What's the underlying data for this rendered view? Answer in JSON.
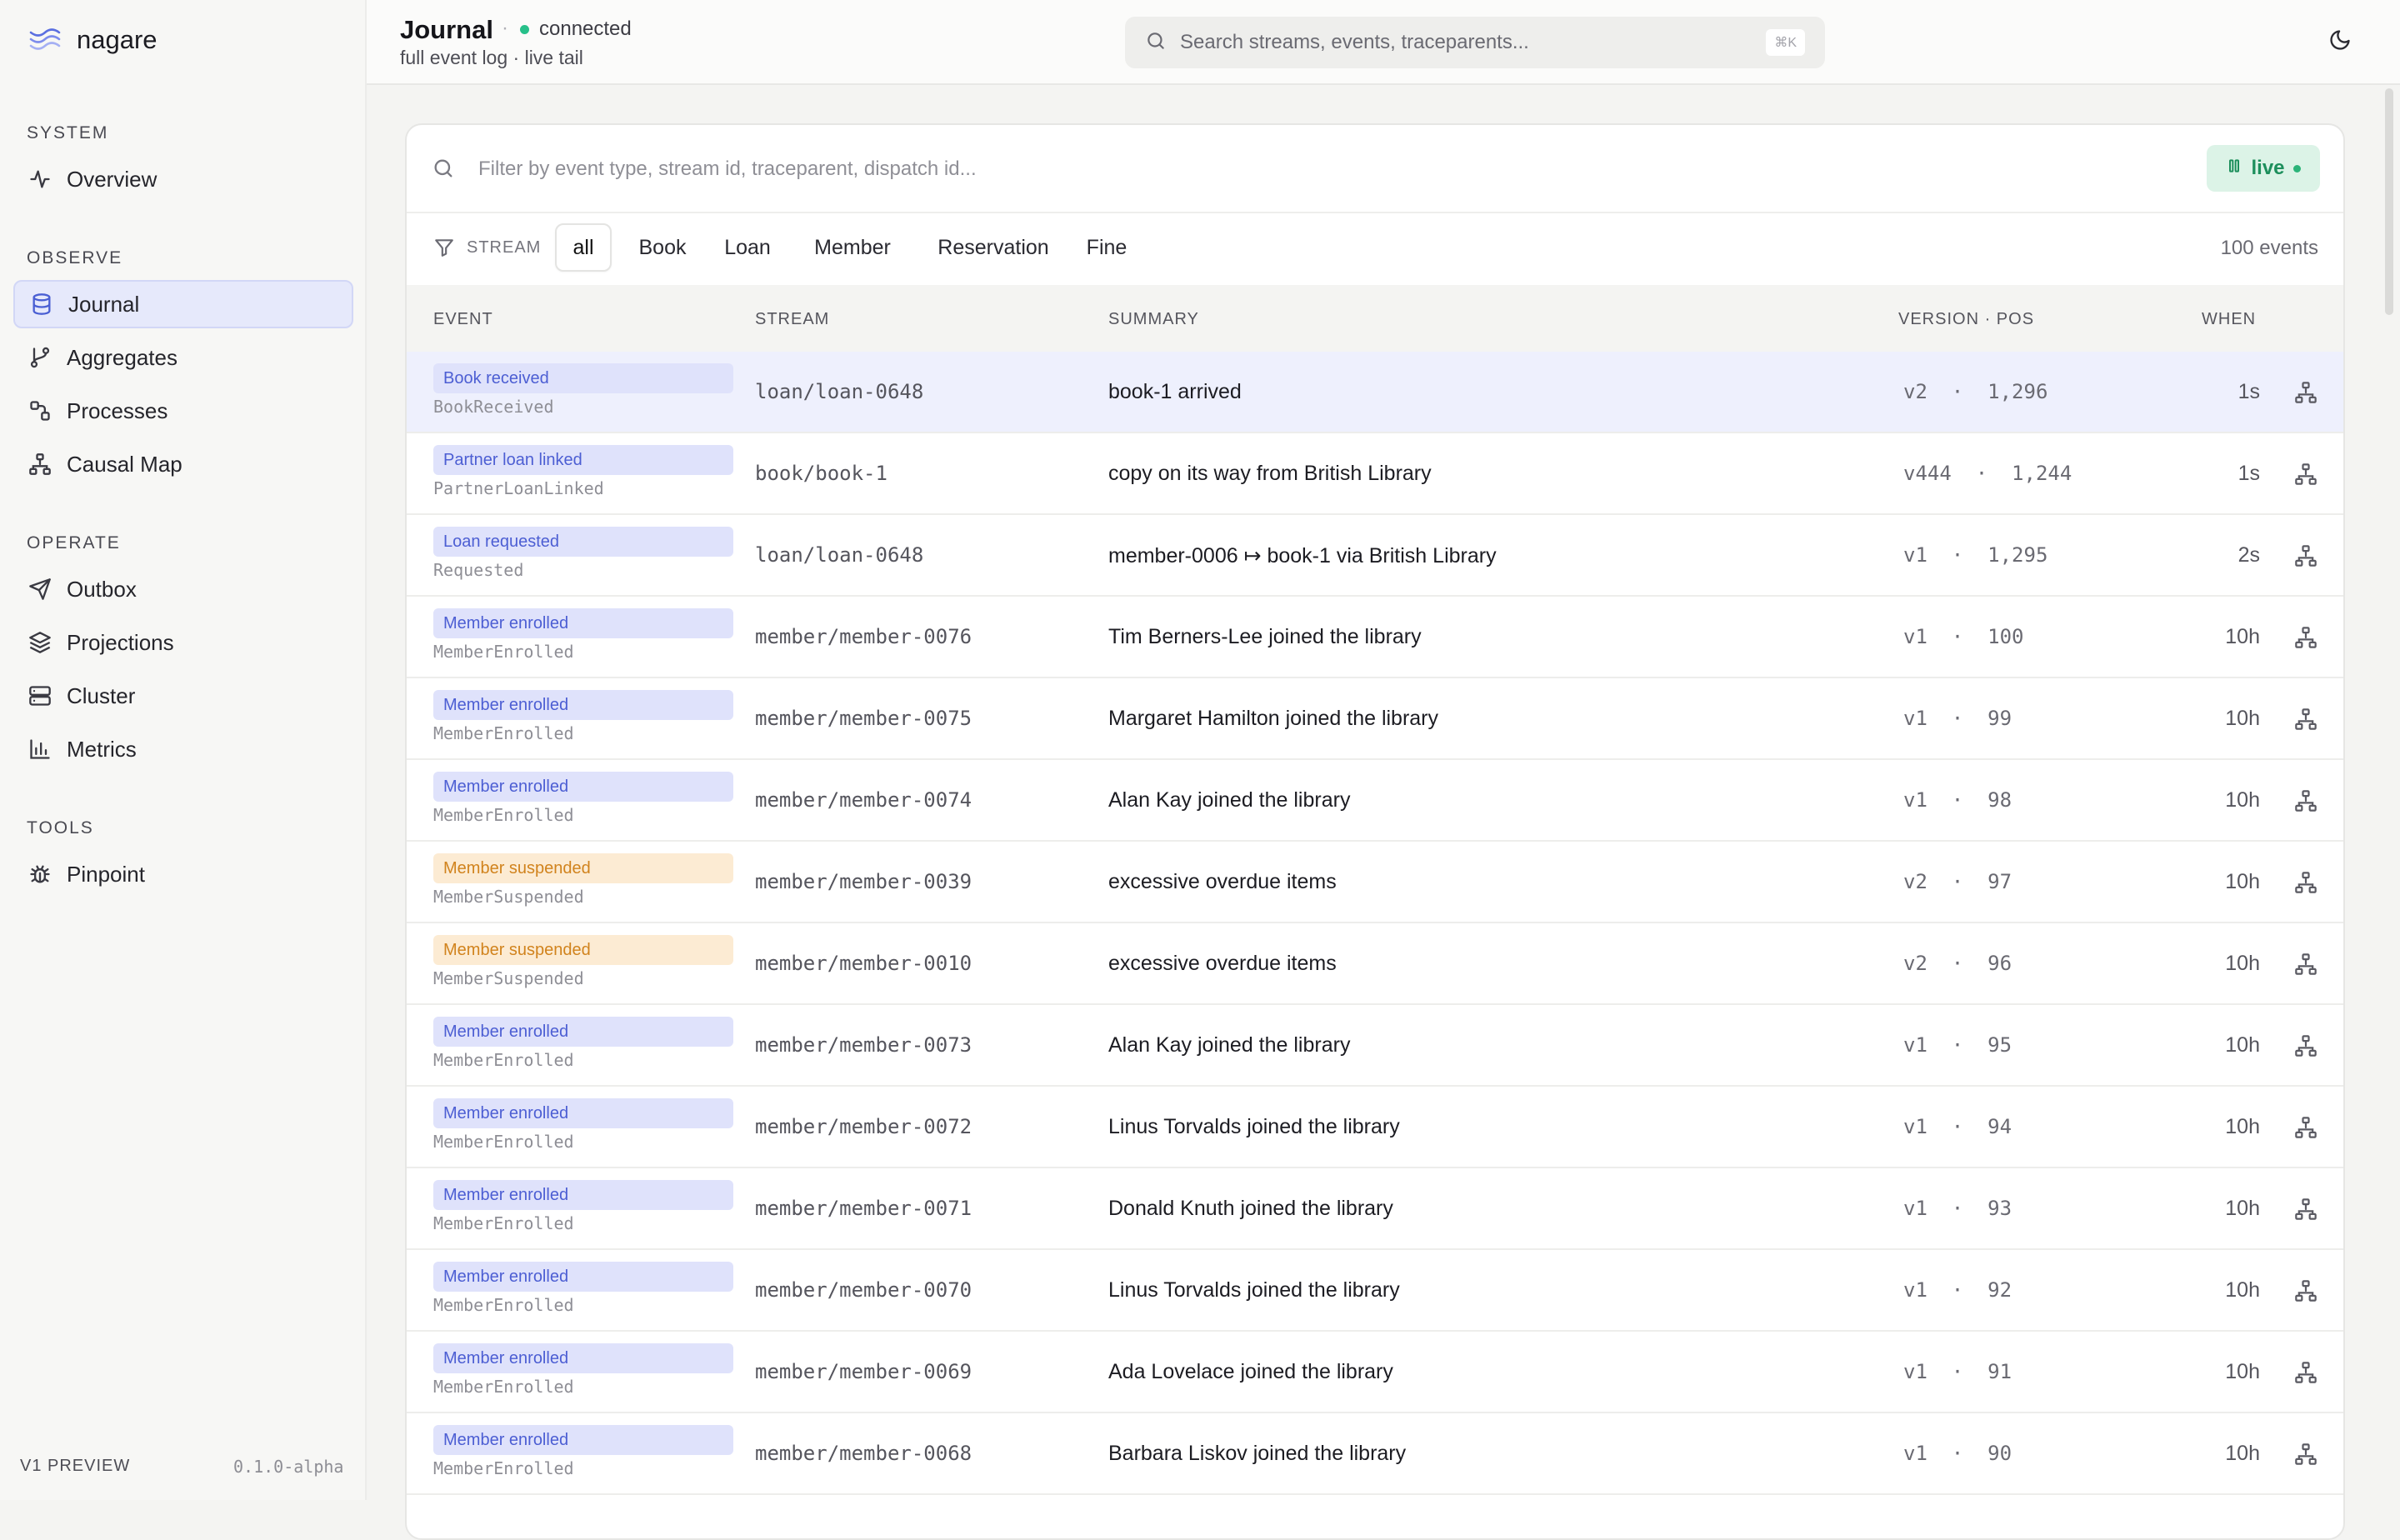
{
  "brand": {
    "name": "nagare"
  },
  "sidebar": {
    "sections": {
      "system": "SYSTEM",
      "observe": "OBSERVE",
      "operate": "OPERATE",
      "tools": "TOOLS"
    },
    "items": {
      "overview": {
        "label": "Overview",
        "icon": "activity-icon"
      },
      "journal": {
        "label": "Journal",
        "icon": "database-icon",
        "active": true
      },
      "aggregates": {
        "label": "Aggregates",
        "icon": "git-branch-icon"
      },
      "processes": {
        "label": "Processes",
        "icon": "workflow-icon"
      },
      "causal_map": {
        "label": "Causal Map",
        "icon": "hierarchy-icon"
      },
      "outbox": {
        "label": "Outbox",
        "icon": "send-icon"
      },
      "projections": {
        "label": "Projections",
        "icon": "layers-icon"
      },
      "cluster": {
        "label": "Cluster",
        "icon": "server-icon"
      },
      "metrics": {
        "label": "Metrics",
        "icon": "bar-chart-icon"
      },
      "pinpoint": {
        "label": "Pinpoint",
        "icon": "bug-icon"
      }
    },
    "footer": {
      "preview": "V1 PREVIEW",
      "version": "0.1.0-alpha"
    }
  },
  "header": {
    "title": "Journal",
    "separator": "·",
    "status": "connected",
    "status_color": "#27c08a",
    "subtitle": "full event log · live tail",
    "search_placeholder": "Search streams, events, traceparents...",
    "shortcut": "⌘K"
  },
  "journal": {
    "filter_placeholder": "Filter by event type, stream id, traceparent, dispatch id...",
    "live_label": "live",
    "stream_label": "STREAM",
    "tabs": [
      "all",
      "Book",
      "Loan",
      "Member",
      "Reservation",
      "Fine"
    ],
    "active_tab": "all",
    "count": "100 events",
    "columns": {
      "event": "EVENT",
      "stream": "STREAM",
      "summary": "SUMMARY",
      "version_pos": "VERSION · POS",
      "when": "WHEN"
    },
    "rows": [
      {
        "label": "Book received",
        "type": "BookReceived",
        "stream": "loan/loan-0648",
        "summary": "book-1 arrived",
        "version": "v2",
        "pos": "1,296",
        "when": "1s",
        "tone": "indigo"
      },
      {
        "label": "Partner loan linked",
        "type": "PartnerLoanLinked",
        "stream": "book/book-1",
        "summary": "copy on its way from British Library",
        "version": "v444",
        "pos": "1,244",
        "when": "1s",
        "tone": "indigo"
      },
      {
        "label": "Loan requested",
        "type": "Requested",
        "stream": "loan/loan-0648",
        "summary": "member-0006 ↦ book-1 via British Library",
        "version": "v1",
        "pos": "1,295",
        "when": "2s",
        "tone": "indigo"
      },
      {
        "label": "Member enrolled",
        "type": "MemberEnrolled",
        "stream": "member/member-0076",
        "summary": "Tim Berners-Lee joined the library",
        "version": "v1",
        "pos": "100",
        "when": "10h",
        "tone": "indigo"
      },
      {
        "label": "Member enrolled",
        "type": "MemberEnrolled",
        "stream": "member/member-0075",
        "summary": "Margaret Hamilton joined the library",
        "version": "v1",
        "pos": "99",
        "when": "10h",
        "tone": "indigo"
      },
      {
        "label": "Member enrolled",
        "type": "MemberEnrolled",
        "stream": "member/member-0074",
        "summary": "Alan Kay joined the library",
        "version": "v1",
        "pos": "98",
        "when": "10h",
        "tone": "indigo"
      },
      {
        "label": "Member suspended",
        "type": "MemberSuspended",
        "stream": "member/member-0039",
        "summary": "excessive overdue items",
        "version": "v2",
        "pos": "97",
        "when": "10h",
        "tone": "amber"
      },
      {
        "label": "Member suspended",
        "type": "MemberSuspended",
        "stream": "member/member-0010",
        "summary": "excessive overdue items",
        "version": "v2",
        "pos": "96",
        "when": "10h",
        "tone": "amber"
      },
      {
        "label": "Member enrolled",
        "type": "MemberEnrolled",
        "stream": "member/member-0073",
        "summary": "Alan Kay joined the library",
        "version": "v1",
        "pos": "95",
        "when": "10h",
        "tone": "indigo"
      },
      {
        "label": "Member enrolled",
        "type": "MemberEnrolled",
        "stream": "member/member-0072",
        "summary": "Linus Torvalds joined the library",
        "version": "v1",
        "pos": "94",
        "when": "10h",
        "tone": "indigo"
      },
      {
        "label": "Member enrolled",
        "type": "MemberEnrolled",
        "stream": "member/member-0071",
        "summary": "Donald Knuth joined the library",
        "version": "v1",
        "pos": "93",
        "when": "10h",
        "tone": "indigo"
      },
      {
        "label": "Member enrolled",
        "type": "MemberEnrolled",
        "stream": "member/member-0070",
        "summary": "Linus Torvalds joined the library",
        "version": "v1",
        "pos": "92",
        "when": "10h",
        "tone": "indigo"
      },
      {
        "label": "Member enrolled",
        "type": "MemberEnrolled",
        "stream": "member/member-0069",
        "summary": "Ada Lovelace joined the library",
        "version": "v1",
        "pos": "91",
        "when": "10h",
        "tone": "indigo"
      },
      {
        "label": "Member enrolled",
        "type": "MemberEnrolled",
        "stream": "member/member-0068",
        "summary": "Barbara Liskov joined the library",
        "version": "v1",
        "pos": "90",
        "when": "10h",
        "tone": "indigo"
      }
    ]
  },
  "colors": {
    "accent": "#4c5ed3",
    "live": "#1d8f5c",
    "amber": "#d1831d"
  }
}
